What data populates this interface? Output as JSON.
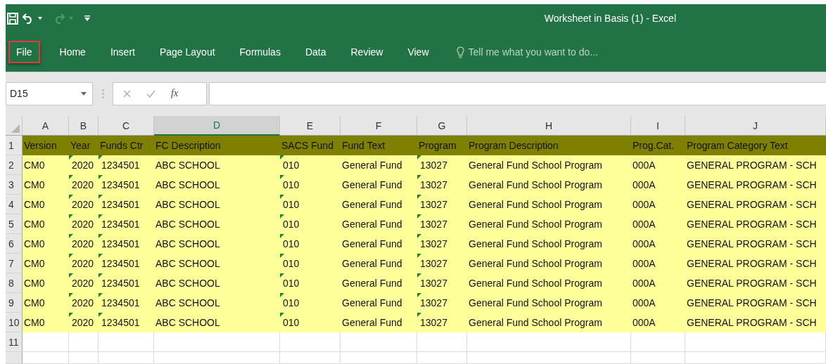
{
  "window": {
    "title": "Worksheet in Basis (1) - Excel"
  },
  "quick_access": {
    "redo_disabled": true
  },
  "tabs": [
    {
      "label": "File",
      "highlighted": true
    },
    {
      "label": "Home",
      "highlighted": false
    },
    {
      "label": "Insert",
      "highlighted": false
    },
    {
      "label": "Page Layout",
      "highlighted": false
    },
    {
      "label": "Formulas",
      "highlighted": false
    },
    {
      "label": "Data",
      "highlighted": false
    },
    {
      "label": "Review",
      "highlighted": false
    },
    {
      "label": "View",
      "highlighted": false
    }
  ],
  "tell_me": {
    "placeholder": "Tell me what you want to do..."
  },
  "formula_bar": {
    "name_box": "D15",
    "function_symbol": "fx"
  },
  "columns": [
    {
      "letter": "A",
      "selected": false,
      "text_flag": false
    },
    {
      "letter": "B",
      "selected": false,
      "text_flag": true
    },
    {
      "letter": "C",
      "selected": false,
      "text_flag": true
    },
    {
      "letter": "D",
      "selected": true,
      "text_flag": false
    },
    {
      "letter": "E",
      "selected": false,
      "text_flag": true
    },
    {
      "letter": "F",
      "selected": false,
      "text_flag": false
    },
    {
      "letter": "G",
      "selected": false,
      "text_flag": true
    },
    {
      "letter": "H",
      "selected": false,
      "text_flag": false
    },
    {
      "letter": "I",
      "selected": false,
      "text_flag": false
    },
    {
      "letter": "J",
      "selected": false,
      "text_flag": false
    }
  ],
  "rows": [
    {
      "number": "1",
      "kind": "header",
      "cells": [
        "Version",
        "Year",
        "Funds Ctr",
        "FC Description",
        "SACS Fund",
        "Fund Text",
        "Program",
        "Program Description",
        "Prog.Cat.",
        "Program Category Text"
      ]
    },
    {
      "number": "2",
      "kind": "data",
      "cells": [
        "CM0",
        "2020",
        "1234501",
        "ABC SCHOOL",
        "010",
        "General Fund",
        "13027",
        "General Fund School Program",
        "000A",
        "GENERAL PROGRAM - SCH"
      ]
    },
    {
      "number": "3",
      "kind": "data",
      "cells": [
        "CM0",
        "2020",
        "1234501",
        "ABC SCHOOL",
        "010",
        "General Fund",
        "13027",
        "General Fund School Program",
        "000A",
        "GENERAL PROGRAM - SCH"
      ]
    },
    {
      "number": "4",
      "kind": "data",
      "cells": [
        "CM0",
        "2020",
        "1234501",
        "ABC SCHOOL",
        "010",
        "General Fund",
        "13027",
        "General Fund School Program",
        "000A",
        "GENERAL PROGRAM - SCH"
      ]
    },
    {
      "number": "5",
      "kind": "data",
      "cells": [
        "CM0",
        "2020",
        "1234501",
        "ABC SCHOOL",
        "010",
        "General Fund",
        "13027",
        "General Fund School Program",
        "000A",
        "GENERAL PROGRAM - SCH"
      ]
    },
    {
      "number": "6",
      "kind": "data",
      "cells": [
        "CM0",
        "2020",
        "1234501",
        "ABC SCHOOL",
        "010",
        "General Fund",
        "13027",
        "General Fund School Program",
        "000A",
        "GENERAL PROGRAM - SCH"
      ]
    },
    {
      "number": "7",
      "kind": "data",
      "cells": [
        "CM0",
        "2020",
        "1234501",
        "ABC SCHOOL",
        "010",
        "General Fund",
        "13027",
        "General Fund School Program",
        "000A",
        "GENERAL PROGRAM - SCH"
      ]
    },
    {
      "number": "8",
      "kind": "data",
      "cells": [
        "CM0",
        "2020",
        "1234501",
        "ABC SCHOOL",
        "010",
        "General Fund",
        "13027",
        "General Fund School Program",
        "000A",
        "GENERAL PROGRAM - SCH"
      ]
    },
    {
      "number": "9",
      "kind": "data",
      "cells": [
        "CM0",
        "2020",
        "1234501",
        "ABC SCHOOL",
        "010",
        "General Fund",
        "13027",
        "General Fund School Program",
        "000A",
        "GENERAL PROGRAM - SCH"
      ]
    },
    {
      "number": "10",
      "kind": "data",
      "cells": [
        "CM0",
        "2020",
        "1234501",
        "ABC SCHOOL",
        "010",
        "General Fund",
        "13027",
        "General Fund School Program",
        "000A",
        "GENERAL PROGRAM - SCH"
      ]
    },
    {
      "number": "11",
      "kind": "empty",
      "cells": []
    }
  ]
}
